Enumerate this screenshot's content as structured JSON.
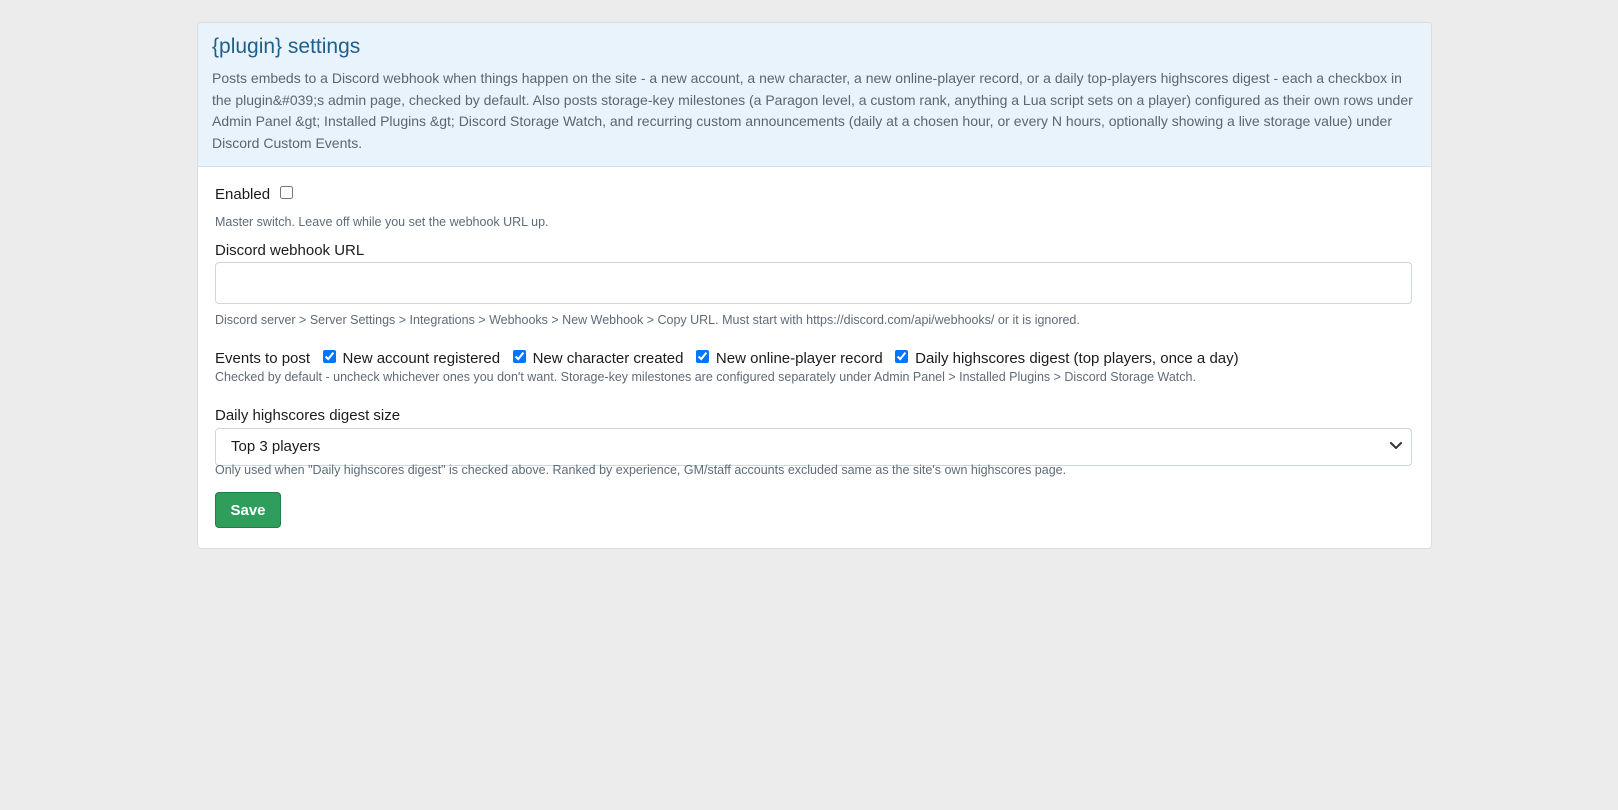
{
  "card": {
    "title": "{plugin} settings",
    "description": "Posts embeds to a Discord webhook when things happen on the site - a new account, a new character, a new online-player record, or a daily top-players highscores digest - each a checkbox in the plugin&#039;s admin page, checked by default. Also posts storage-key milestones (a Paragon level, a custom rank, anything a Lua script sets on a player) configured as their own rows under Admin Panel &gt; Installed Plugins &gt; Discord Storage Watch, and recurring custom announcements (daily at a chosen hour, or every N hours, optionally showing a live storage value) under Discord Custom Events."
  },
  "fields": {
    "enabled": {
      "label": "Enabled",
      "checked": false,
      "help": "Master switch. Leave off while you set the webhook URL up."
    },
    "webhook": {
      "label": "Discord webhook URL",
      "value": "",
      "help": "Discord server > Server Settings > Integrations > Webhooks > New Webhook > Copy URL. Must start with https://discord.com/api/webhooks/ or it is ignored."
    },
    "events": {
      "label": "Events to post",
      "options": [
        {
          "label": "New account registered",
          "checked": true
        },
        {
          "label": "New character created",
          "checked": true
        },
        {
          "label": "New online-player record",
          "checked": true
        },
        {
          "label": "Daily highscores digest (top players, once a day)",
          "checked": true
        }
      ],
      "help": "Checked by default - uncheck whichever ones you don't want. Storage-key milestones are configured separately under Admin Panel > Installed Plugins > Discord Storage Watch."
    },
    "digest": {
      "label": "Daily highscores digest size",
      "selected": "Top 3 players",
      "help": "Only used when \"Daily highscores digest\" is checked above. Ranked by experience, GM/staff accounts excluded same as the site's own highscores page."
    }
  },
  "actions": {
    "save_label": "Save"
  },
  "colors": {
    "page_background": "#ececec",
    "header_background": "#e8f3fb",
    "title": "#1f5f8b",
    "save_button": "#2f9e5d"
  },
  "icons": {
    "select_indicator": "chevron-down-icon"
  }
}
